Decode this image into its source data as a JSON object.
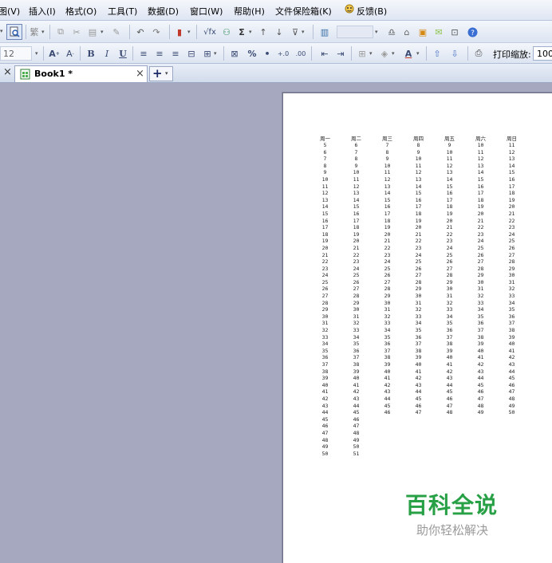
{
  "menus": [
    "图(V)",
    "插入(I)",
    "格式(O)",
    "工具(T)",
    "数据(D)",
    "窗口(W)",
    "帮助(H)",
    "文件保险箱(K)",
    "反馈(B)"
  ],
  "toolbar": {
    "traditional_label": "繁",
    "sum_label": "Σ",
    "sqrt_label": "√fx",
    "font_size": "12",
    "bold": "B",
    "italic": "I",
    "underline": "U",
    "percent": "%",
    "print_zoom_label": "打印缩放:",
    "print_zoom_value": "100"
  },
  "tabs": {
    "close_label": "×",
    "active_name": "Book1 *",
    "new_label": "+"
  },
  "calendar": {
    "headers": [
      "周一",
      "周二",
      "周三",
      "周四",
      "周五",
      "周六",
      "周日"
    ],
    "columns": [
      [
        5,
        6,
        7,
        8,
        9,
        10,
        11,
        12,
        13,
        14,
        15,
        16,
        17,
        18,
        19,
        20,
        21,
        22,
        23,
        24,
        25,
        26,
        27,
        28,
        29,
        30,
        31,
        32,
        33,
        34,
        35,
        36,
        37,
        38,
        39,
        40,
        41,
        42,
        43,
        44,
        45,
        46,
        47,
        48,
        49,
        50
      ],
      [
        6,
        7,
        8,
        9,
        10,
        11,
        12,
        13,
        14,
        15,
        16,
        17,
        18,
        19,
        20,
        21,
        22,
        23,
        24,
        25,
        26,
        27,
        28,
        29,
        30,
        31,
        32,
        33,
        34,
        35,
        36,
        37,
        38,
        39,
        40,
        41,
        42,
        43,
        44,
        45,
        46,
        47,
        48,
        49,
        50,
        51
      ],
      [
        7,
        8,
        9,
        10,
        11,
        12,
        13,
        14,
        15,
        16,
        17,
        18,
        19,
        20,
        21,
        22,
        23,
        24,
        25,
        26,
        27,
        28,
        29,
        30,
        31,
        32,
        33,
        34,
        35,
        36,
        37,
        38,
        39,
        40,
        41,
        42,
        43,
        44,
        45,
        46
      ],
      [
        8,
        9,
        10,
        11,
        12,
        13,
        14,
        15,
        16,
        17,
        18,
        19,
        20,
        21,
        22,
        23,
        24,
        25,
        26,
        27,
        28,
        29,
        30,
        31,
        32,
        33,
        34,
        35,
        36,
        37,
        38,
        39,
        40,
        41,
        42,
        43,
        44,
        45,
        46,
        47
      ],
      [
        9,
        10,
        11,
        12,
        13,
        14,
        15,
        16,
        17,
        18,
        19,
        20,
        21,
        22,
        23,
        24,
        25,
        26,
        27,
        28,
        29,
        30,
        31,
        32,
        33,
        34,
        35,
        36,
        37,
        38,
        39,
        40,
        41,
        42,
        43,
        44,
        45,
        46,
        47,
        48
      ],
      [
        10,
        11,
        12,
        13,
        14,
        15,
        16,
        17,
        18,
        19,
        20,
        21,
        22,
        23,
        24,
        25,
        26,
        27,
        28,
        29,
        30,
        31,
        32,
        33,
        34,
        35,
        36,
        37,
        38,
        39,
        40,
        41,
        42,
        43,
        44,
        45,
        46,
        47,
        48,
        49
      ],
      [
        11,
        12,
        13,
        14,
        15,
        16,
        17,
        18,
        19,
        20,
        21,
        22,
        23,
        24,
        25,
        26,
        27,
        28,
        29,
        30,
        31,
        32,
        33,
        34,
        35,
        36,
        37,
        38,
        39,
        40,
        41,
        42,
        43,
        44,
        45,
        46,
        47,
        48,
        49,
        50
      ]
    ]
  },
  "watermark": {
    "title": "百科全说",
    "subtitle": "助你轻松解决"
  },
  "colors": {
    "workspace": "#a6a8c0",
    "watermark_green": "#28a046",
    "toolbar": "#e6ecf6"
  }
}
